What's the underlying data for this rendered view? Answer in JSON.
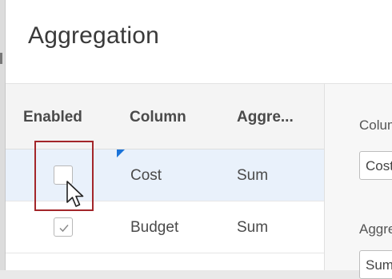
{
  "dialog": {
    "title": "Aggregation"
  },
  "grid": {
    "headers": {
      "enabled": "Enabled",
      "column": "Column",
      "aggregate": "Aggre..."
    },
    "rows": [
      {
        "enabled": false,
        "column": "Cost",
        "aggregate": "Sum"
      },
      {
        "enabled": true,
        "column": "Budget",
        "aggregate": "Sum"
      }
    ]
  },
  "panel": {
    "column_label": "Column",
    "column_value": "Cost",
    "aggregate_label": "Aggregate",
    "aggregate_value": "Sum"
  },
  "colors": {
    "selected_row": "#e9f1fb",
    "focus_outline": "#a3262a",
    "dirty_flag": "#1a73d9"
  }
}
